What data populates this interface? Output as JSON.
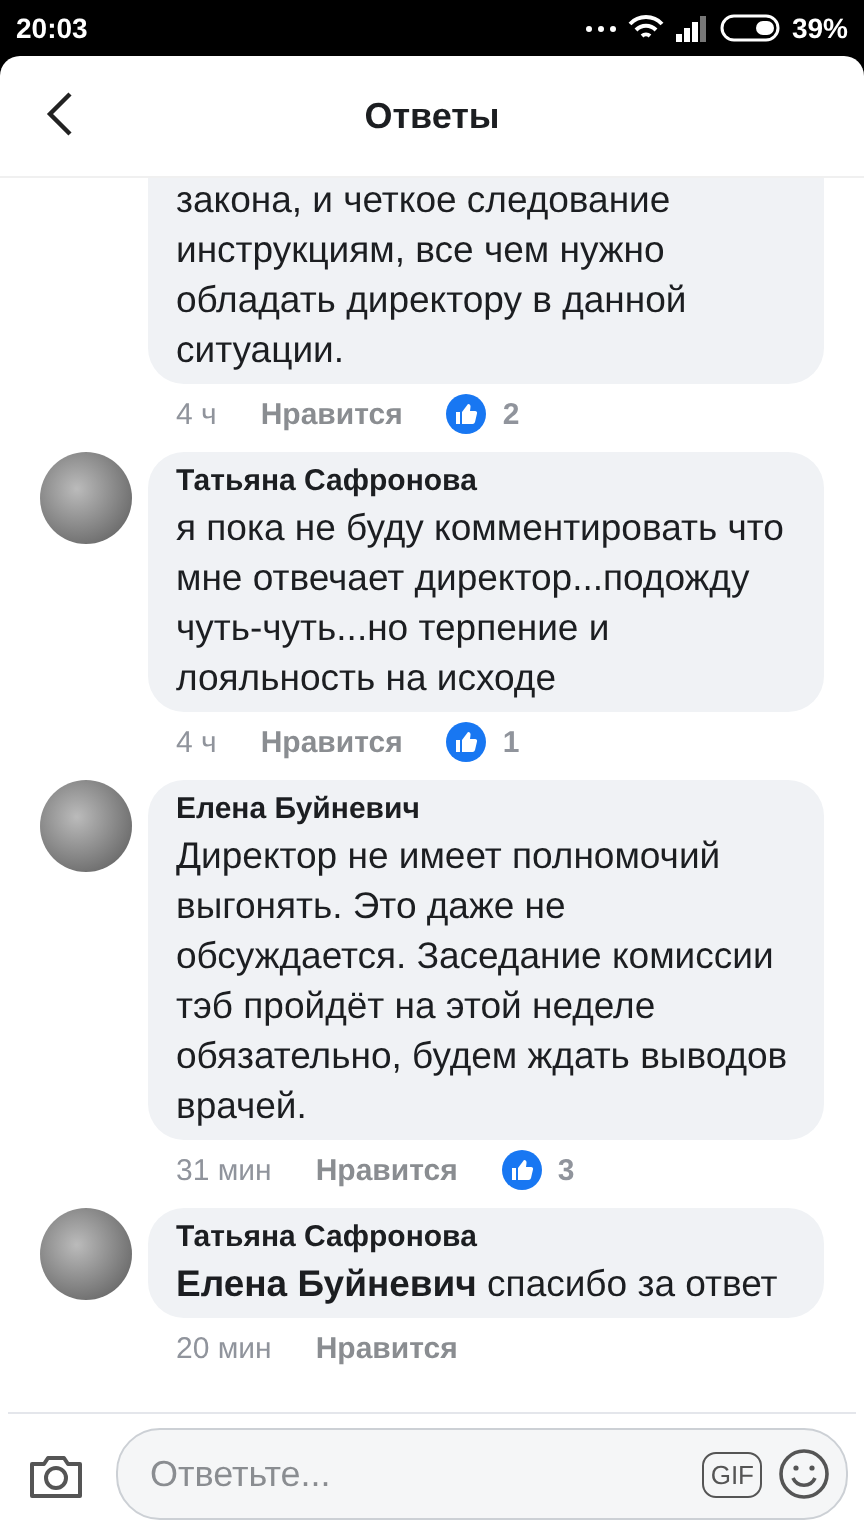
{
  "status_bar": {
    "time": "20:03",
    "battery": "39%"
  },
  "header": {
    "title": "Ответы"
  },
  "comments": [
    {
      "kind": "continued",
      "text": "закона, и  четкое следование инструкциям,  все чем нужно обладать директору в данной ситуации.",
      "time": "4 ч",
      "like_label": "Нравится",
      "likes": "2"
    },
    {
      "kind": "comment",
      "author": "Татьяна Сафронова",
      "text": "я пока не буду комментировать что мне отвечает директор...подожду чуть-чуть...но терпение и лояльность на исходе",
      "time": "4 ч",
      "like_label": "Нравится",
      "likes": "1"
    },
    {
      "kind": "comment",
      "author": "Елена Буйневич",
      "text": "Директор не имеет полномочий выгонять. Это даже не обсуждается. Заседание комиссии тэб пройдёт на этой неделе обязательно, будем ждать выводов врачей.",
      "time": "31 мин",
      "like_label": "Нравится",
      "likes": "3"
    },
    {
      "kind": "comment",
      "author": "Татьяна Сафронова",
      "text": "**Елена Буйневич** спасибо за ответ",
      "time": "20 мин",
      "like_label": "Нравится"
    }
  ],
  "composer": {
    "placeholder": "Ответьте...",
    "gif_label": "GIF"
  }
}
